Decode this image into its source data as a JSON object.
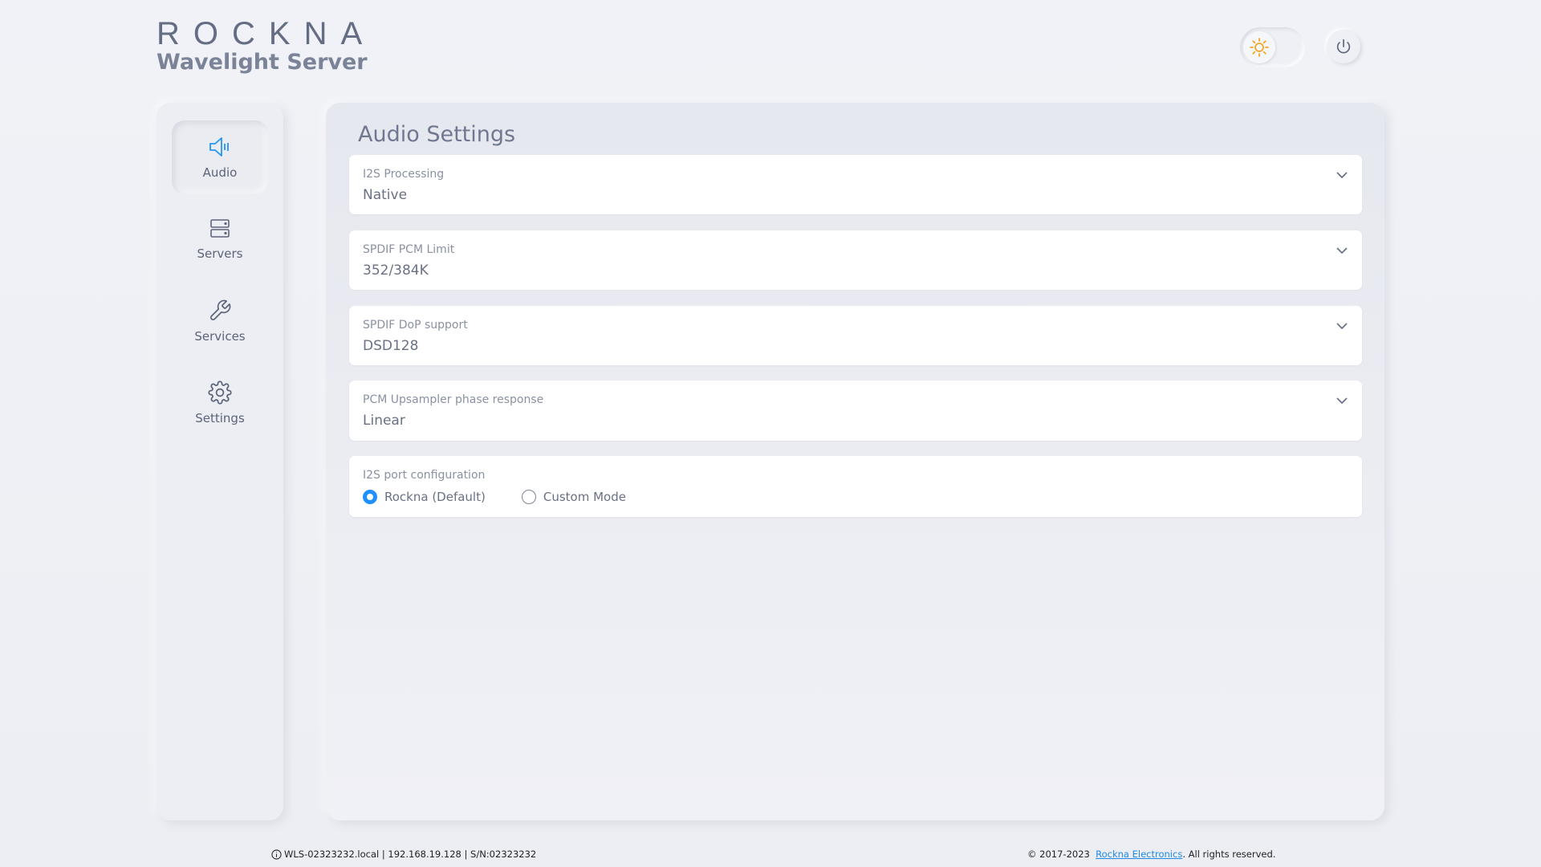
{
  "brand": {
    "logo": "ROCKNA",
    "subtitle": "Wavelight Server"
  },
  "header": {
    "theme_icon": "sun-icon",
    "power_icon": "power-icon"
  },
  "sidebar": {
    "items": [
      {
        "label": "Audio",
        "icon": "speaker-icon",
        "active": true
      },
      {
        "label": "Servers",
        "icon": "server-icon"
      },
      {
        "label": "Services",
        "icon": "wrench-icon"
      },
      {
        "label": "Settings",
        "icon": "gear-icon"
      }
    ]
  },
  "main": {
    "title": "Audio Settings",
    "selects": [
      {
        "label": "I2S Processing",
        "value": "Native"
      },
      {
        "label": "SPDIF PCM Limit",
        "value": "352/384K"
      },
      {
        "label": "SPDIF DoP support",
        "value": "DSD128"
      },
      {
        "label": "PCM Upsampler phase response",
        "value": "Linear"
      }
    ],
    "port_config": {
      "label": "I2S port configuration",
      "options": [
        "Rockna (Default)",
        "Custom Mode"
      ],
      "selected": "Rockna (Default)"
    }
  },
  "footer": {
    "device": "WLS-02323232.local | 192.168.19.128 | S/N:02323232",
    "copyright": "© 2017-2023",
    "company_link": "Rockna Electronics",
    "rights": ". All rights reserved."
  },
  "colors": {
    "accent": "#1e90ff",
    "sun": "#f5a623"
  }
}
